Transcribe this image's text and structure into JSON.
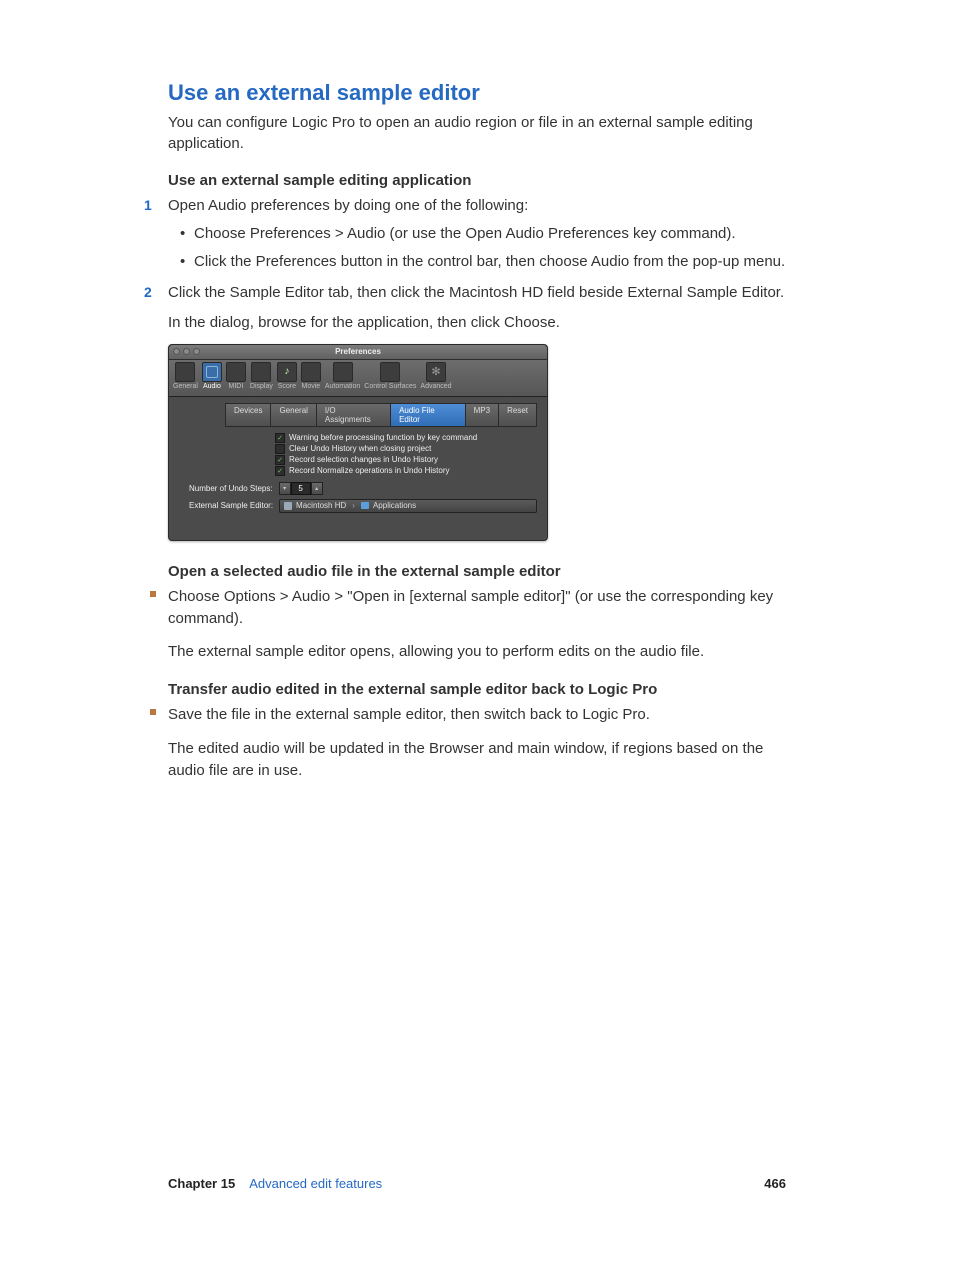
{
  "heading": "Use an external sample editor",
  "intro": "You can configure Logic Pro to open an audio region or file in an external sample editing application.",
  "sub1": "Use an external sample editing application",
  "step1": "Open Audio preferences by doing one of the following:",
  "step1_bullets": [
    "Choose Preferences > Audio (or use the Open Audio Preferences key command).",
    "Click the Preferences button in the control bar, then choose Audio from the pop-up menu."
  ],
  "step2": "Click the Sample Editor tab, then click the Macintosh HD field beside External Sample Editor.",
  "step2_follow": "In the dialog, browse for the application, then click Choose.",
  "prefs": {
    "title": "Preferences",
    "toolbar": [
      "General",
      "Audio",
      "MIDI",
      "Display",
      "Score",
      "Movie",
      "Automation",
      "Control Surfaces",
      "Advanced"
    ],
    "subtabs": [
      "Devices",
      "General",
      "I/O Assignments",
      "Audio File Editor",
      "MP3",
      "Reset"
    ],
    "checks": [
      {
        "on": true,
        "label": "Warning before processing function by key command"
      },
      {
        "on": false,
        "label": "Clear Undo History when closing project"
      },
      {
        "on": true,
        "label": "Record selection changes in Undo History"
      },
      {
        "on": true,
        "label": "Record Normalize operations in Undo History"
      }
    ],
    "undo_label": "Number of Undo Steps:",
    "undo_value": "5",
    "ext_label": "External Sample Editor:",
    "path1": "Macintosh HD",
    "path2": "Applications"
  },
  "sub2": "Open a selected audio file in the external sample editor",
  "sub2_item": "Choose Options > Audio > \"Open in [external sample editor]\" (or use the corresponding key command).",
  "sub2_follow": "The external sample editor opens, allowing you to perform edits on the audio file.",
  "sub3": "Transfer audio edited in the external sample editor back to Logic Pro",
  "sub3_item": "Save the file in the external sample editor, then switch back to Logic Pro.",
  "sub3_follow": "The edited audio will be updated in the Browser and main window, if regions based on the audio file are in use.",
  "footer": {
    "chapter": "Chapter  15",
    "name": "Advanced edit features",
    "page": "466"
  }
}
